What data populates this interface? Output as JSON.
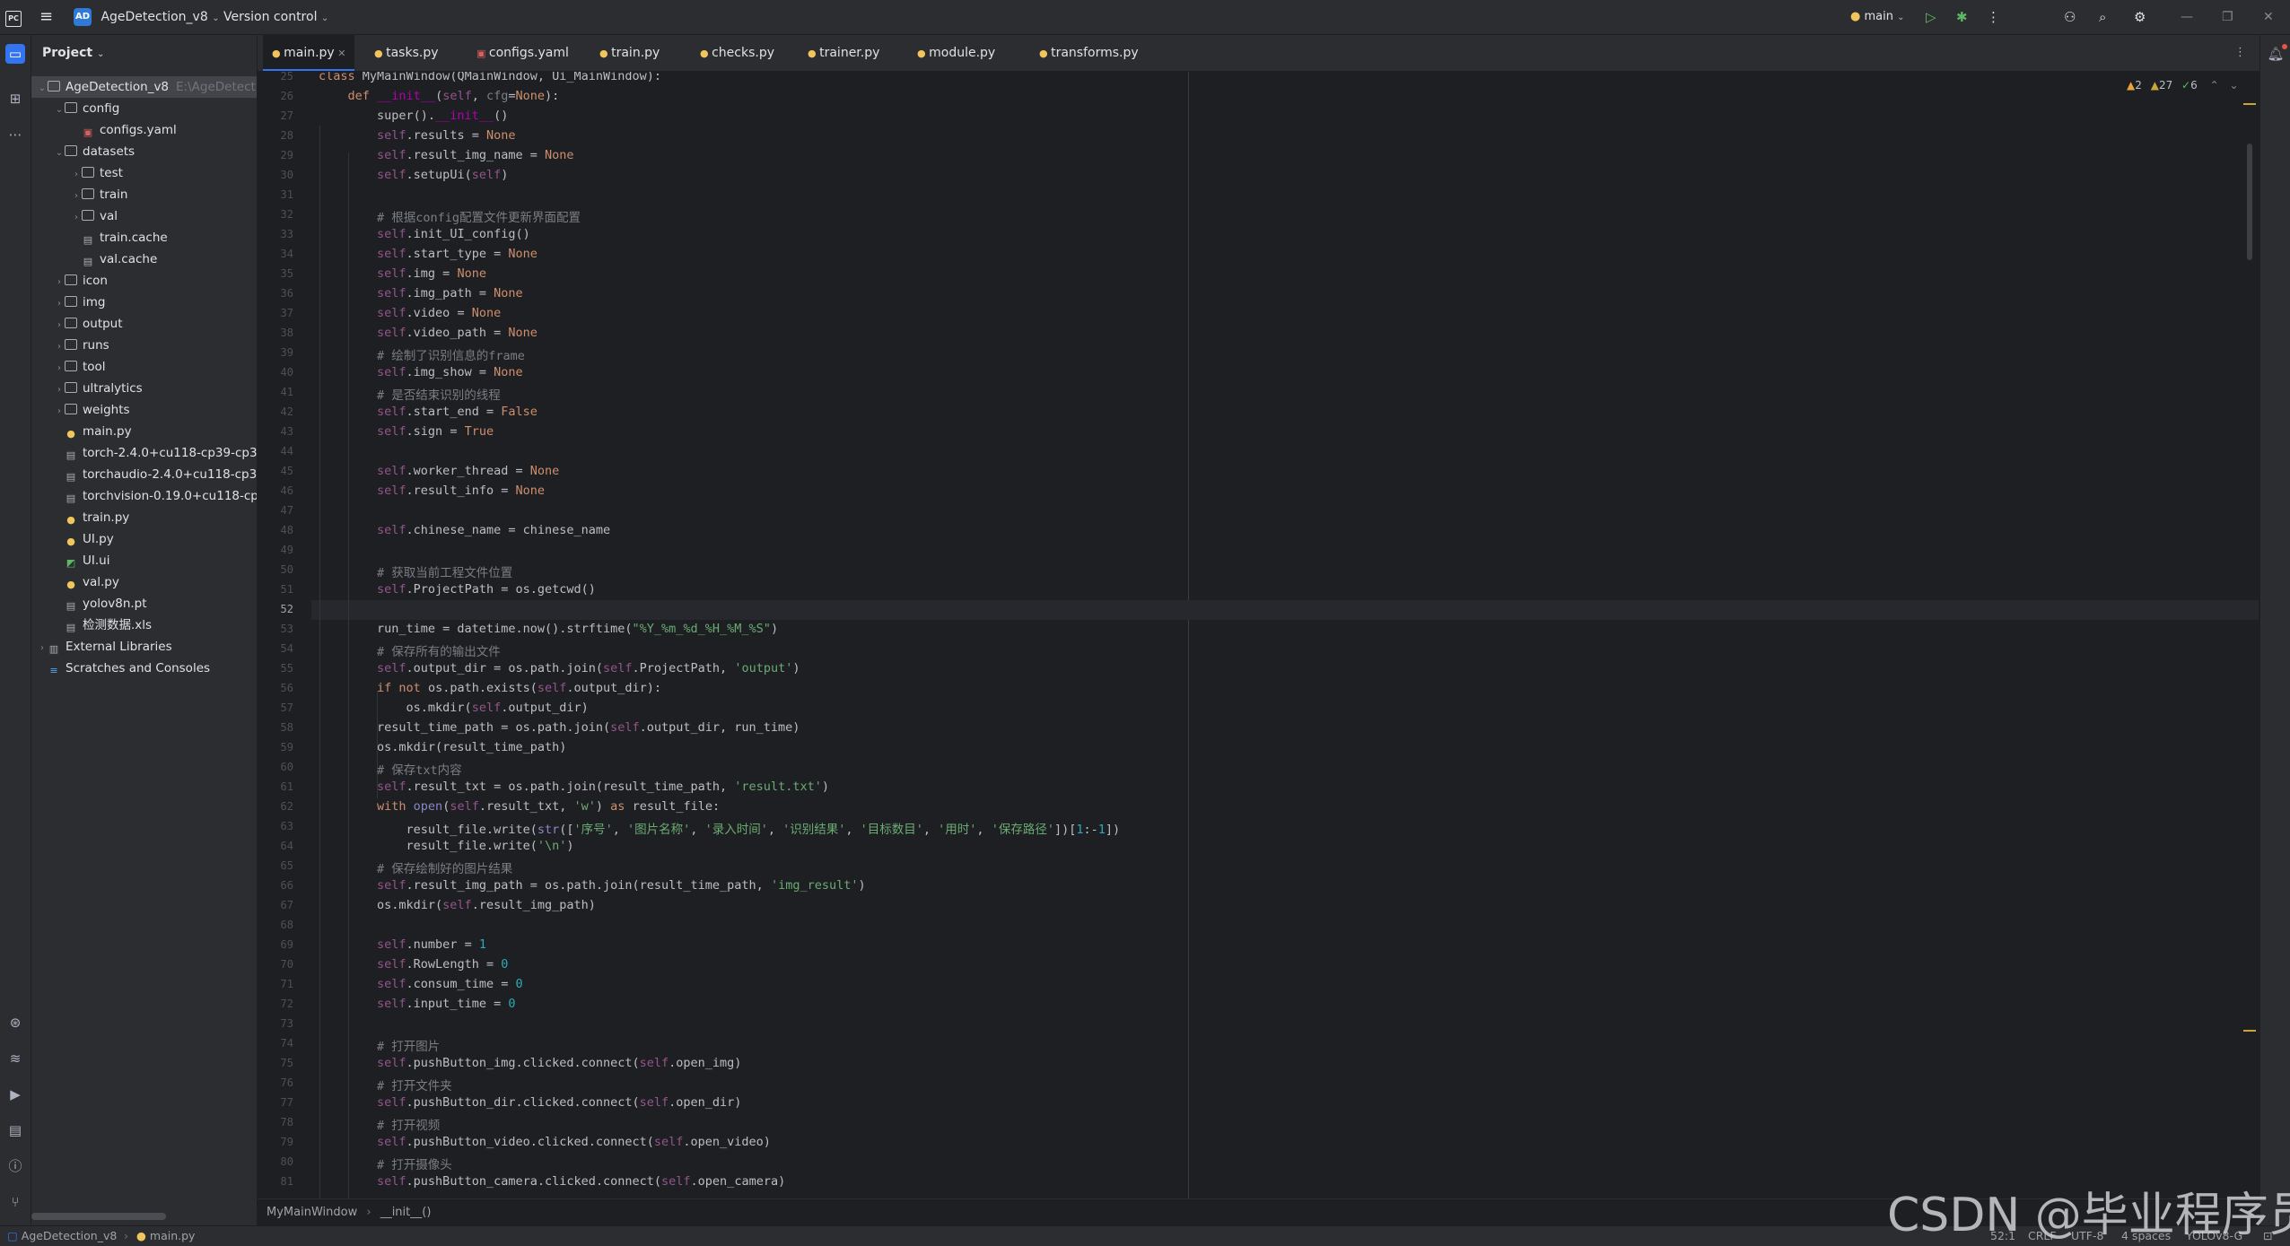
{
  "titlebar": {
    "project_badge": "AD",
    "project_name": "AgeDetection_v8",
    "vcs": "Version control",
    "branch": "main"
  },
  "project_panel": {
    "title": "Project",
    "tree": [
      {
        "label": "AgeDetection_v8",
        "hint": "E:\\AgeDetect",
        "kind": "folder",
        "depth": 0,
        "open": true
      },
      {
        "label": "config",
        "kind": "folder",
        "depth": 1,
        "open": true
      },
      {
        "label": "configs.yaml",
        "kind": "yaml",
        "depth": 2
      },
      {
        "label": "datasets",
        "kind": "folder",
        "depth": 1,
        "open": true
      },
      {
        "label": "test",
        "kind": "folder",
        "depth": 2,
        "open": false
      },
      {
        "label": "train",
        "kind": "folder",
        "depth": 2,
        "open": false
      },
      {
        "label": "val",
        "kind": "folder",
        "depth": 2,
        "open": false
      },
      {
        "label": "train.cache",
        "kind": "file",
        "depth": 2
      },
      {
        "label": "val.cache",
        "kind": "file",
        "depth": 2
      },
      {
        "label": "icon",
        "kind": "folder",
        "depth": 1,
        "open": false
      },
      {
        "label": "img",
        "kind": "folder",
        "depth": 1,
        "open": false
      },
      {
        "label": "output",
        "kind": "folder",
        "depth": 1,
        "open": false
      },
      {
        "label": "runs",
        "kind": "folder",
        "depth": 1,
        "open": false
      },
      {
        "label": "tool",
        "kind": "folder",
        "depth": 1,
        "open": false
      },
      {
        "label": "ultralytics",
        "kind": "folder",
        "depth": 1,
        "open": false
      },
      {
        "label": "weights",
        "kind": "folder",
        "depth": 1,
        "open": false
      },
      {
        "label": "main.py",
        "kind": "python",
        "depth": 1
      },
      {
        "label": "torch-2.4.0+cu118-cp39-cp3",
        "kind": "file",
        "depth": 1
      },
      {
        "label": "torchaudio-2.4.0+cu118-cp3",
        "kind": "file",
        "depth": 1
      },
      {
        "label": "torchvision-0.19.0+cu118-cp",
        "kind": "file",
        "depth": 1
      },
      {
        "label": "train.py",
        "kind": "python",
        "depth": 1
      },
      {
        "label": "UI.py",
        "kind": "python",
        "depth": 1
      },
      {
        "label": "UI.ui",
        "kind": "ui",
        "depth": 1
      },
      {
        "label": "val.py",
        "kind": "python",
        "depth": 1
      },
      {
        "label": "yolov8n.pt",
        "kind": "file",
        "depth": 1
      },
      {
        "label": "检测数据.xls",
        "kind": "file",
        "depth": 1
      },
      {
        "label": "External Libraries",
        "kind": "library",
        "depth": 0,
        "open": false
      },
      {
        "label": "Scratches and Consoles",
        "kind": "scratch",
        "depth": 0
      }
    ]
  },
  "tabs": [
    {
      "label": "main.py",
      "kind": "python",
      "active": true
    },
    {
      "label": "tasks.py",
      "kind": "python"
    },
    {
      "label": "configs.yaml",
      "kind": "yaml"
    },
    {
      "label": "train.py",
      "kind": "python"
    },
    {
      "label": "checks.py",
      "kind": "python"
    },
    {
      "label": "trainer.py",
      "kind": "python"
    },
    {
      "label": "module.py",
      "kind": "python"
    },
    {
      "label": "transforms.py",
      "kind": "python"
    }
  ],
  "inspections": {
    "warnings": "2",
    "weak_warnings": "27",
    "typos": "6"
  },
  "editor": {
    "first_line": 25,
    "current_line": 52,
    "lines": [
      [
        [
          "k",
          "class "
        ],
        [
          "t",
          "MyMainWindow(QMainWindow, Ui_MainWindow):"
        ]
      ],
      [
        [
          "t",
          "    "
        ],
        [
          "k",
          "def "
        ],
        [
          "dunder",
          "__init__"
        ],
        [
          "t",
          "("
        ],
        [
          "self",
          "self"
        ],
        [
          "t",
          ", "
        ],
        [
          "param",
          "cfg"
        ],
        [
          "t",
          "="
        ],
        [
          "k",
          "None"
        ],
        [
          "t",
          "):"
        ]
      ],
      [
        [
          "t",
          "        super()."
        ],
        [
          "dunder",
          "__init__"
        ],
        [
          "t",
          "()"
        ]
      ],
      [
        [
          "t",
          "        "
        ],
        [
          "self",
          "self"
        ],
        [
          "t",
          ".results = "
        ],
        [
          "k",
          "None"
        ]
      ],
      [
        [
          "t",
          "        "
        ],
        [
          "self",
          "self"
        ],
        [
          "t",
          ".result_img_name = "
        ],
        [
          "k",
          "None"
        ]
      ],
      [
        [
          "t",
          "        "
        ],
        [
          "self",
          "self"
        ],
        [
          "t",
          ".setupUi("
        ],
        [
          "self",
          "self"
        ],
        [
          "t",
          ")"
        ]
      ],
      [],
      [
        [
          "c",
          "        # 根据config配置文件更新界面配置"
        ]
      ],
      [
        [
          "t",
          "        "
        ],
        [
          "self",
          "self"
        ],
        [
          "t",
          ".init_UI_config()"
        ]
      ],
      [
        [
          "t",
          "        "
        ],
        [
          "self",
          "self"
        ],
        [
          "t",
          ".start_type = "
        ],
        [
          "k",
          "None"
        ]
      ],
      [
        [
          "t",
          "        "
        ],
        [
          "self",
          "self"
        ],
        [
          "t",
          ".img = "
        ],
        [
          "k",
          "None"
        ]
      ],
      [
        [
          "t",
          "        "
        ],
        [
          "self",
          "self"
        ],
        [
          "t",
          ".img_path = "
        ],
        [
          "k",
          "None"
        ]
      ],
      [
        [
          "t",
          "        "
        ],
        [
          "self",
          "self"
        ],
        [
          "t",
          ".video = "
        ],
        [
          "k",
          "None"
        ]
      ],
      [
        [
          "t",
          "        "
        ],
        [
          "self",
          "self"
        ],
        [
          "t",
          ".video_path = "
        ],
        [
          "k",
          "None"
        ]
      ],
      [
        [
          "c",
          "        # 绘制了识别信息的frame"
        ]
      ],
      [
        [
          "t",
          "        "
        ],
        [
          "self",
          "self"
        ],
        [
          "t",
          ".img_show = "
        ],
        [
          "k",
          "None"
        ]
      ],
      [
        [
          "c",
          "        # 是否结束识别的线程"
        ]
      ],
      [
        [
          "t",
          "        "
        ],
        [
          "self",
          "self"
        ],
        [
          "t",
          ".start_end = "
        ],
        [
          "k",
          "False"
        ]
      ],
      [
        [
          "t",
          "        "
        ],
        [
          "self",
          "self"
        ],
        [
          "t",
          ".sign = "
        ],
        [
          "k",
          "True"
        ]
      ],
      [],
      [
        [
          "t",
          "        "
        ],
        [
          "self",
          "self"
        ],
        [
          "t",
          ".worker_thread = "
        ],
        [
          "k",
          "None"
        ]
      ],
      [
        [
          "t",
          "        "
        ],
        [
          "self",
          "self"
        ],
        [
          "t",
          ".result_info = "
        ],
        [
          "k",
          "None"
        ]
      ],
      [],
      [
        [
          "t",
          "        "
        ],
        [
          "self",
          "self"
        ],
        [
          "t",
          ".chinese_name = chinese_name"
        ]
      ],
      [],
      [
        [
          "c",
          "        # 获取当前工程文件位置"
        ]
      ],
      [
        [
          "t",
          "        "
        ],
        [
          "self",
          "self"
        ],
        [
          "t",
          ".ProjectPath = os.getcwd()"
        ]
      ],
      [],
      [
        [
          "t",
          "        run_time = datetime.now().strftime("
        ],
        [
          "s",
          "\"%Y_%m_%d_%H_%M_%S\""
        ],
        [
          "t",
          ")"
        ]
      ],
      [
        [
          "c",
          "        # 保存所有的输出文件"
        ]
      ],
      [
        [
          "t",
          "        "
        ],
        [
          "self",
          "self"
        ],
        [
          "t",
          ".output_dir = os.path.join("
        ],
        [
          "self",
          "self"
        ],
        [
          "t",
          ".ProjectPath, "
        ],
        [
          "s",
          "'output'"
        ],
        [
          "t",
          ")"
        ]
      ],
      [
        [
          "t",
          "        "
        ],
        [
          "k",
          "if not "
        ],
        [
          "t",
          "os.path.exists("
        ],
        [
          "self",
          "self"
        ],
        [
          "t",
          ".output_dir):"
        ]
      ],
      [
        [
          "t",
          "            os.mkdir("
        ],
        [
          "self",
          "self"
        ],
        [
          "t",
          ".output_dir)"
        ]
      ],
      [
        [
          "t",
          "        result_time_path = os.path.join("
        ],
        [
          "self",
          "self"
        ],
        [
          "t",
          ".output_dir, run_time)"
        ]
      ],
      [
        [
          "t",
          "        os.mkdir(result_time_path)"
        ]
      ],
      [
        [
          "c",
          "        # 保存txt内容"
        ]
      ],
      [
        [
          "t",
          "        "
        ],
        [
          "self",
          "self"
        ],
        [
          "t",
          ".result_txt = os.path.join(result_time_path, "
        ],
        [
          "s",
          "'result.txt'"
        ],
        [
          "t",
          ")"
        ]
      ],
      [
        [
          "t",
          "        "
        ],
        [
          "k",
          "with "
        ],
        [
          "bi",
          "open"
        ],
        [
          "t",
          "("
        ],
        [
          "self",
          "self"
        ],
        [
          "t",
          ".result_txt, "
        ],
        [
          "s",
          "'w'"
        ],
        [
          "t",
          ") "
        ],
        [
          "k",
          "as "
        ],
        [
          "t",
          "result_file:"
        ]
      ],
      [
        [
          "t",
          "            result_file.write("
        ],
        [
          "bi",
          "str"
        ],
        [
          "t",
          "(["
        ],
        [
          "s",
          "'序号'"
        ],
        [
          "t",
          ", "
        ],
        [
          "s",
          "'图片名称'"
        ],
        [
          "t",
          ", "
        ],
        [
          "s",
          "'录入时间'"
        ],
        [
          "t",
          ", "
        ],
        [
          "s",
          "'识别结果'"
        ],
        [
          "t",
          ", "
        ],
        [
          "s",
          "'目标数目'"
        ],
        [
          "t",
          ", "
        ],
        [
          "s",
          "'用时'"
        ],
        [
          "t",
          ", "
        ],
        [
          "s",
          "'保存路径'"
        ],
        [
          "t",
          "])["
        ],
        [
          "n",
          "1"
        ],
        [
          "t",
          ":-"
        ],
        [
          "n",
          "1"
        ],
        [
          "t",
          "])"
        ]
      ],
      [
        [
          "t",
          "            result_file.write("
        ],
        [
          "s",
          "'\\n'"
        ],
        [
          "t",
          ")"
        ]
      ],
      [
        [
          "c",
          "        # 保存绘制好的图片结果"
        ]
      ],
      [
        [
          "t",
          "        "
        ],
        [
          "self",
          "self"
        ],
        [
          "t",
          ".result_img_path = os.path.join(result_time_path, "
        ],
        [
          "s",
          "'img_result'"
        ],
        [
          "t",
          ")"
        ]
      ],
      [
        [
          "t",
          "        os.mkdir("
        ],
        [
          "self",
          "self"
        ],
        [
          "t",
          ".result_img_path)"
        ]
      ],
      [],
      [
        [
          "t",
          "        "
        ],
        [
          "self",
          "self"
        ],
        [
          "t",
          ".number = "
        ],
        [
          "n",
          "1"
        ]
      ],
      [
        [
          "t",
          "        "
        ],
        [
          "self",
          "self"
        ],
        [
          "t",
          ".RowLength = "
        ],
        [
          "n",
          "0"
        ]
      ],
      [
        [
          "t",
          "        "
        ],
        [
          "self",
          "self"
        ],
        [
          "t",
          ".consum_time = "
        ],
        [
          "n",
          "0"
        ]
      ],
      [
        [
          "t",
          "        "
        ],
        [
          "self",
          "self"
        ],
        [
          "t",
          ".input_time = "
        ],
        [
          "n",
          "0"
        ]
      ],
      [],
      [
        [
          "c",
          "        # 打开图片"
        ]
      ],
      [
        [
          "t",
          "        "
        ],
        [
          "self",
          "self"
        ],
        [
          "t",
          ".pushButton_img.clicked.connect("
        ],
        [
          "self",
          "self"
        ],
        [
          "t",
          ".open_img)"
        ]
      ],
      [
        [
          "c",
          "        # 打开文件夹"
        ]
      ],
      [
        [
          "t",
          "        "
        ],
        [
          "self",
          "self"
        ],
        [
          "t",
          ".pushButton_dir.clicked.connect("
        ],
        [
          "self",
          "self"
        ],
        [
          "t",
          ".open_dir)"
        ]
      ],
      [
        [
          "c",
          "        # 打开视频"
        ]
      ],
      [
        [
          "t",
          "        "
        ],
        [
          "self",
          "self"
        ],
        [
          "t",
          ".pushButton_video.clicked.connect("
        ],
        [
          "self",
          "self"
        ],
        [
          "t",
          ".open_video)"
        ]
      ],
      [
        [
          "c",
          "        # 打开摄像头"
        ]
      ],
      [
        [
          "t",
          "        "
        ],
        [
          "self",
          "self"
        ],
        [
          "t",
          ".pushButton_camera.clicked.connect("
        ],
        [
          "self",
          "self"
        ],
        [
          "t",
          ".open_camera)"
        ]
      ]
    ]
  },
  "breadcrumbs": {
    "class_name": "MyMainWindow",
    "method_name": "__init__()"
  },
  "statusbar": {
    "project": "AgeDetection_v8",
    "file": "main.py",
    "position": "52:1",
    "line_sep": "CRLF",
    "encoding": "UTF-8",
    "indent": "4 spaces",
    "interpreter": "YOLOv8-G"
  },
  "watermark": "CSDN @毕业程序员"
}
